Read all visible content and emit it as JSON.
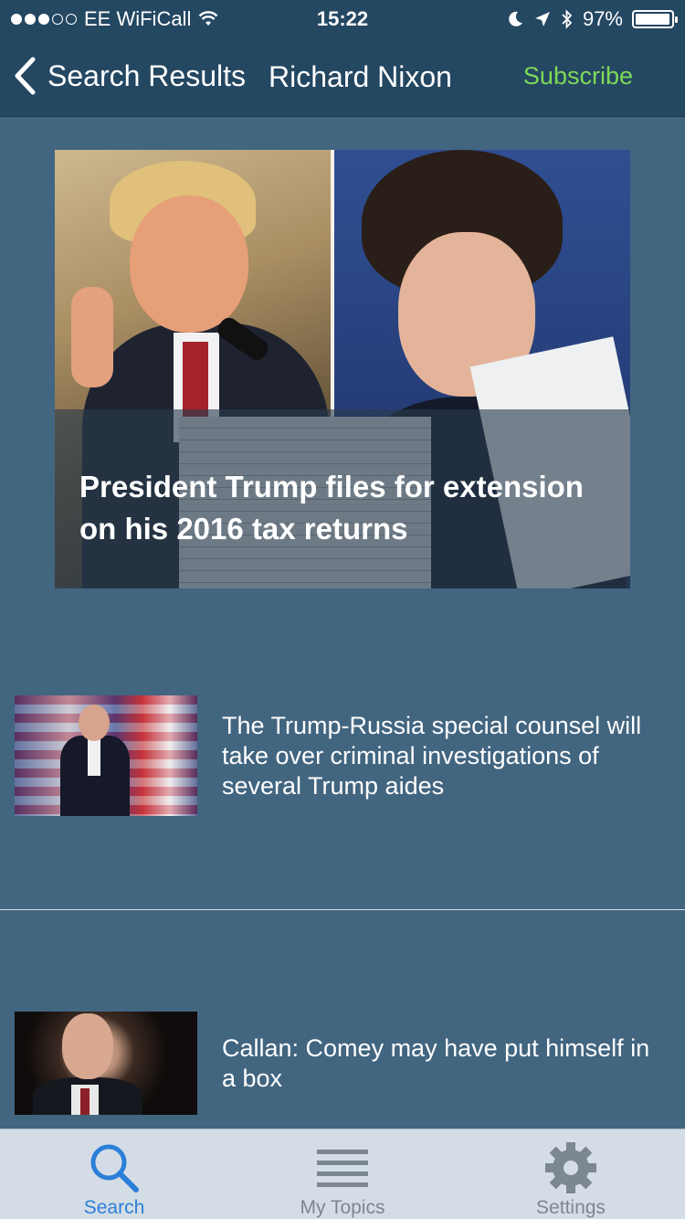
{
  "status_bar": {
    "carrier": "EE WiFiCall",
    "time": "15:22",
    "battery": "97%",
    "battery_level": 0.97
  },
  "nav": {
    "back_label": "Search Results",
    "title": "Richard Nixon",
    "subscribe_label": "Subscribe"
  },
  "hero": {
    "title": "President Trump files for extension on his 2016 tax returns"
  },
  "items": [
    {
      "title": "The Trump-Russia special counsel will take over criminal investigations of several Trump aides"
    },
    {
      "title": "Callan: Comey may have put himself in a box"
    }
  ],
  "tabs": [
    {
      "label": "Search",
      "icon": "search-icon",
      "active": true
    },
    {
      "label": "My Topics",
      "icon": "list-icon",
      "active": false
    },
    {
      "label": "Settings",
      "icon": "gear-icon",
      "active": false
    }
  ],
  "colors": {
    "background": "#426580",
    "header": "#244762",
    "subscribe": "#7ed957",
    "tab_active": "#2b7fd8",
    "tab_inactive": "#7c8790",
    "tab_bar": "#d4dde5"
  }
}
